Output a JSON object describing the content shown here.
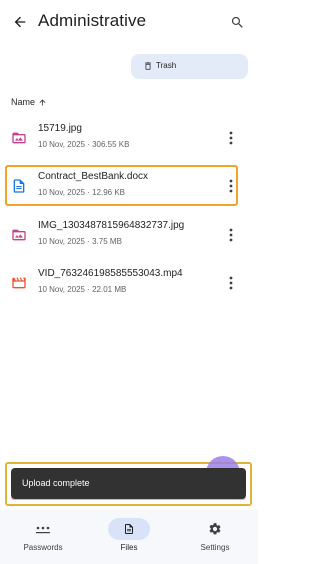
{
  "header": {
    "title": "Administrative",
    "back_icon": "arrow-left-icon",
    "search_icon": "search-icon"
  },
  "trash": {
    "label": "Trash",
    "icon": "trash-icon"
  },
  "sort": {
    "label": "Name",
    "direction_icon": "arrow-up-icon"
  },
  "files": [
    {
      "name": "15719.jpg",
      "meta": "10 Nov, 2025 · 306.55 KB",
      "icon": "image-folder-icon"
    },
    {
      "name": "Contract_BestBank.docx",
      "meta": "10 Nov, 2025 · 12.96 KB",
      "icon": "document-icon"
    },
    {
      "name": "IMG_13034878159648327​37.jpg",
      "meta": "10 Nov, 2025 · 3.75 MB",
      "icon": "image-folder-icon"
    },
    {
      "name": "VID_7632461985855530​43.mp4",
      "meta": "10 Nov, 2025 · 22.01 MB",
      "icon": "video-icon"
    }
  ],
  "snackbar": {
    "text": "Upload complete"
  },
  "nav": {
    "items": [
      {
        "label": "Passwords",
        "icon": "password-dots-icon"
      },
      {
        "label": "Files",
        "icon": "file-icon"
      },
      {
        "label": "Settings",
        "icon": "gear-icon"
      }
    ]
  },
  "colors": {
    "accent": "#1a73e8",
    "image_icon": "#c5418e",
    "video_icon": "#e8542f",
    "highlight": "#f2a32a",
    "snackbar_bg": "#323232",
    "nav_active_bg": "#d8e3f7",
    "chip_bg": "#e3ebf8"
  }
}
